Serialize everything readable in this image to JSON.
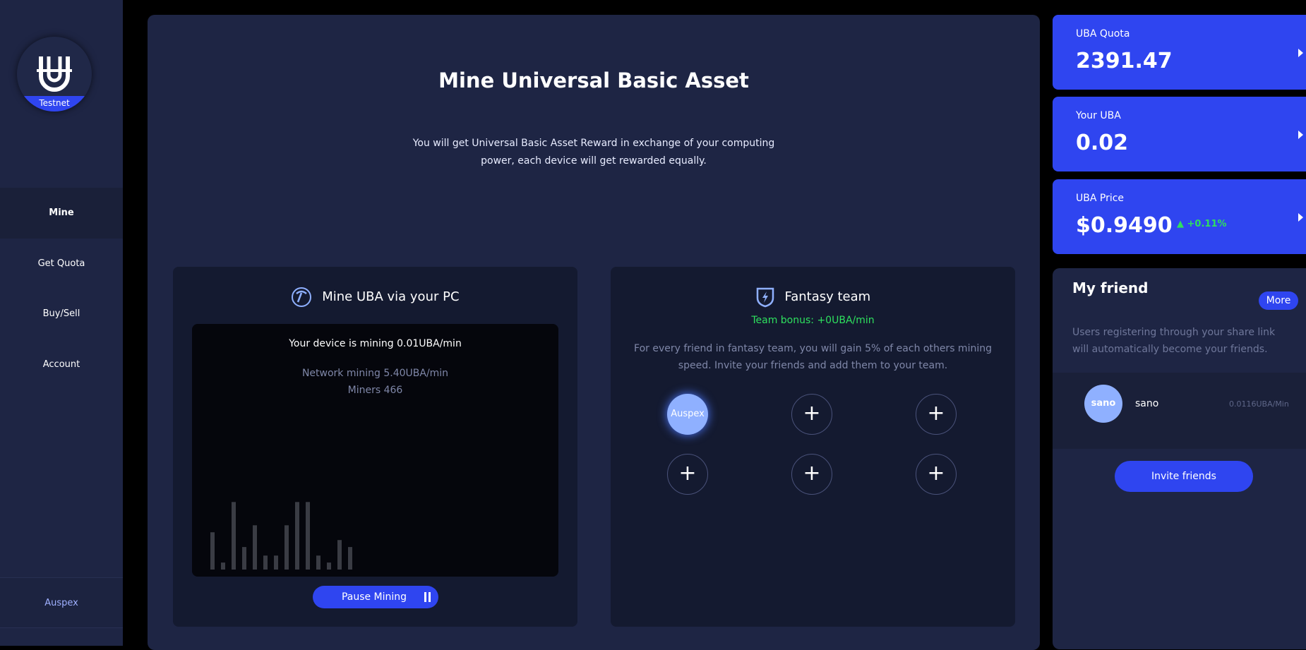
{
  "sidebar": {
    "badge": "Testnet",
    "items": [
      {
        "label": "Mine",
        "active": true
      },
      {
        "label": "Get Quota",
        "active": false
      },
      {
        "label": "Buy/Sell",
        "active": false
      },
      {
        "label": "Account",
        "active": false
      }
    ],
    "user": "Auspex"
  },
  "main": {
    "title": "Mine Universal Basic Asset",
    "description": "You will get Universal Basic Asset Reward in exchange of your computing power, each device will get rewarded equally."
  },
  "mine_card": {
    "title": "Mine UBA via your PC",
    "device_rate": "Your device is mining 0.01UBA/min",
    "network_rate": "Network mining 5.40UBA/min",
    "miners": "Miners 466",
    "bar_levels": [
      0.48,
      0.09,
      0.87,
      0.29,
      0.57,
      0.18,
      0.18,
      0.57,
      0.87,
      0.87,
      0.18,
      0.09,
      0.38,
      0.29
    ],
    "pause_label": "Pause Mining"
  },
  "team_card": {
    "title": "Fantasy team",
    "bonus": "Team bonus: +0UBA/min",
    "description": "For every friend in fantasy team, you will gain 5% of each others mining speed. Invite your friends and add them to your team.",
    "slots": [
      "Auspex",
      "+",
      "+",
      "+",
      "+",
      "+"
    ]
  },
  "stats": {
    "quota": {
      "label": "UBA Quota",
      "value": "2391.47"
    },
    "your_uba": {
      "label": "Your UBA",
      "value": "0.02"
    },
    "price": {
      "label": "UBA Price",
      "value": "$0.9490",
      "change": "▲ +0.11%"
    }
  },
  "friends": {
    "title": "My friend",
    "more_label": "More",
    "description": "Users registering through your share link will automatically become your friends.",
    "list": [
      {
        "avatar": "sano",
        "name": "sano",
        "rate": "0.0116UBA/Min"
      }
    ],
    "invite_label": "Invite friends"
  },
  "colors": {
    "accent": "#2f45f0",
    "positive": "#2ee05e",
    "panel": "#1e2544"
  }
}
